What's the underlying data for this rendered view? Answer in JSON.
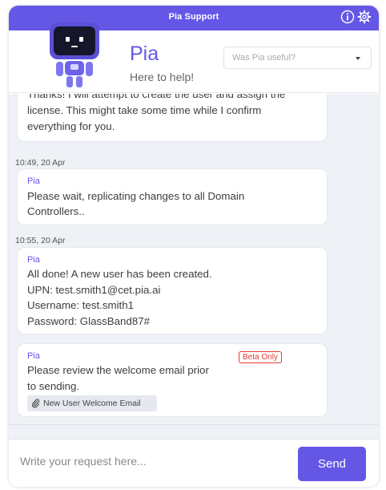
{
  "titlebar": {
    "title": "Pia Support",
    "info_icon": "info-icon",
    "settings_icon": "gear-icon"
  },
  "header": {
    "bot_name": "Pia",
    "tagline": "Here to help!",
    "rating_placeholder": "Was Pia useful?"
  },
  "messages": [
    {
      "lines": [
        "Thanks! I will attempt to create the user and assign the",
        "license. This might take some time while I confirm",
        "everything for you."
      ]
    },
    {
      "timestamp": "10:49, 20 Apr",
      "sender": "Pia",
      "lines": [
        "Please wait, replicating changes to all Domain",
        "Controllers.."
      ]
    },
    {
      "timestamp": "10:55, 20 Apr",
      "sender": "Pia",
      "lines": [
        "All done! A new user has been created.",
        "UPN: test.smith1@cet.pia.ai",
        "Username: test.smith1",
        "Password: GlassBand87#"
      ]
    },
    {
      "sender": "Pia",
      "badge": "Beta Only",
      "lines": [
        "Please review the welcome email prior",
        "to sending."
      ],
      "attachment": "New User Welcome Email"
    }
  ],
  "composer": {
    "placeholder": "Write your request here...",
    "send_label": "Send"
  },
  "colors": {
    "accent": "#6557e6",
    "badge": "#e53935",
    "chat_background": "#eef1f6"
  }
}
